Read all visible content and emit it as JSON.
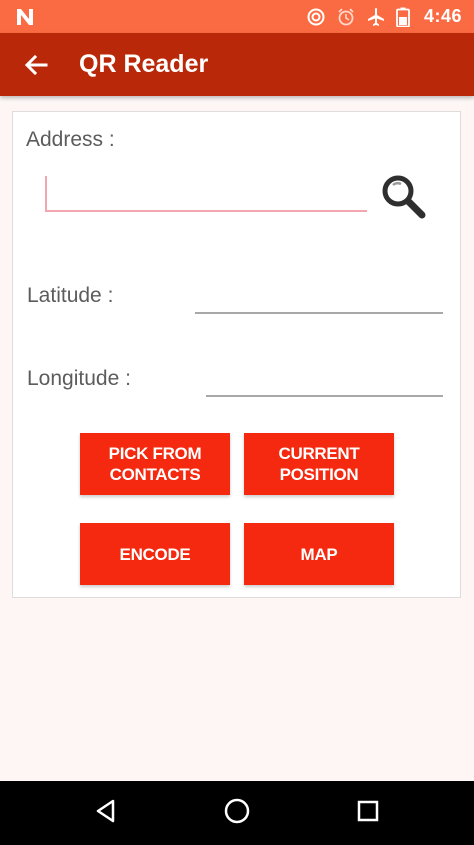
{
  "status_bar": {
    "time": "4:46",
    "icons": [
      "notification-n-icon",
      "sync-icon",
      "alarm-icon",
      "airplane-icon",
      "battery-icon"
    ],
    "color": "#fb6b43"
  },
  "app_bar": {
    "title": "QR Reader",
    "back_icon": "arrow-left-icon",
    "color": "#b92808"
  },
  "form": {
    "address_label": "Address :",
    "address_value": "",
    "latitude_label": "Latitude :",
    "latitude_value": "",
    "longitude_label": "Longitude :",
    "longitude_value": "",
    "search_icon": "magnifier-icon"
  },
  "buttons": {
    "pick_contacts": "PICK FROM\nCONTACTS",
    "current_position": "CURRENT\nPOSITION",
    "encode": "ENCODE",
    "map": "MAP",
    "color": "#f4290f"
  },
  "nav_bar": {
    "back_icon": "nav-back-triangle-icon",
    "home_icon": "nav-home-circle-icon",
    "recents_icon": "nav-recents-square-icon"
  }
}
